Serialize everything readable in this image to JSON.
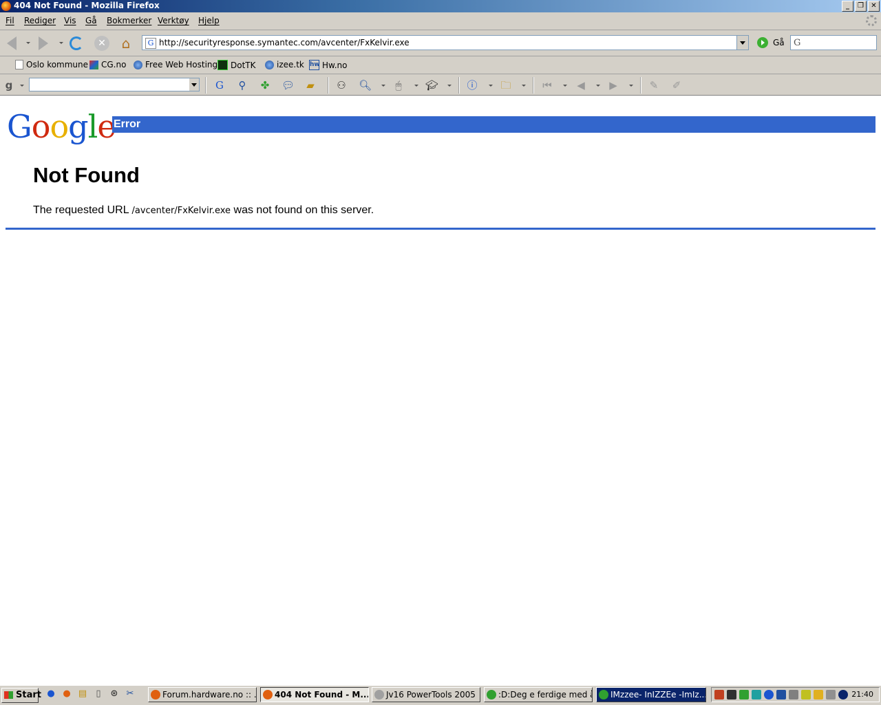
{
  "window": {
    "title": "404 Not Found - Mozilla Firefox",
    "controls": [
      "_",
      "❐",
      "✕"
    ]
  },
  "menu": [
    "Fil",
    "Rediger",
    "Vis",
    "Gå",
    "Bokmerker",
    "Verktøy",
    "Hjelp"
  ],
  "nav": {
    "url": "http://securityresponse.symantec.com/avcenter/FxKelvir.exe",
    "go_label": "Gå",
    "search_engine_glyph": "G"
  },
  "bookmarks": [
    {
      "label": "Oslo kommune",
      "icon": "page-icon"
    },
    {
      "label": "CG.no",
      "icon": "cg-icon"
    },
    {
      "label": "Free Web Hosting",
      "icon": "globe-icon"
    },
    {
      "label": "DotTK",
      "icon": "dottk-icon"
    },
    {
      "label": "izee.tk",
      "icon": "globe-icon"
    },
    {
      "label": "Hw.no",
      "icon": "hw-icon"
    }
  ],
  "page": {
    "logo_letters": [
      "G",
      "o",
      "o",
      "g",
      "l",
      "e"
    ],
    "error_label": "Error",
    "heading": "Not Found",
    "message_prefix": "The requested URL",
    "message_url": "/avcenter/FxKelvir.exe",
    "message_suffix": "was not found on this server."
  },
  "taskbar": {
    "start_label": "Start",
    "tasks": [
      {
        "label": "Forum.hardware.no :: ...",
        "state": "normal"
      },
      {
        "label": "404 Not Found - M...",
        "state": "active"
      },
      {
        "label": "Jv16 PowerTools 2005",
        "state": "normal"
      },
      {
        "label": ":D:Deg e ferdige med å...",
        "state": "normal"
      },
      {
        "label": "IMzzee- InIZZEe -ImIz...",
        "state": "highlight"
      }
    ],
    "clock": "21:40"
  },
  "colors": {
    "google_blue": "#3366cc",
    "title_gradient_start": "#0a246a"
  }
}
